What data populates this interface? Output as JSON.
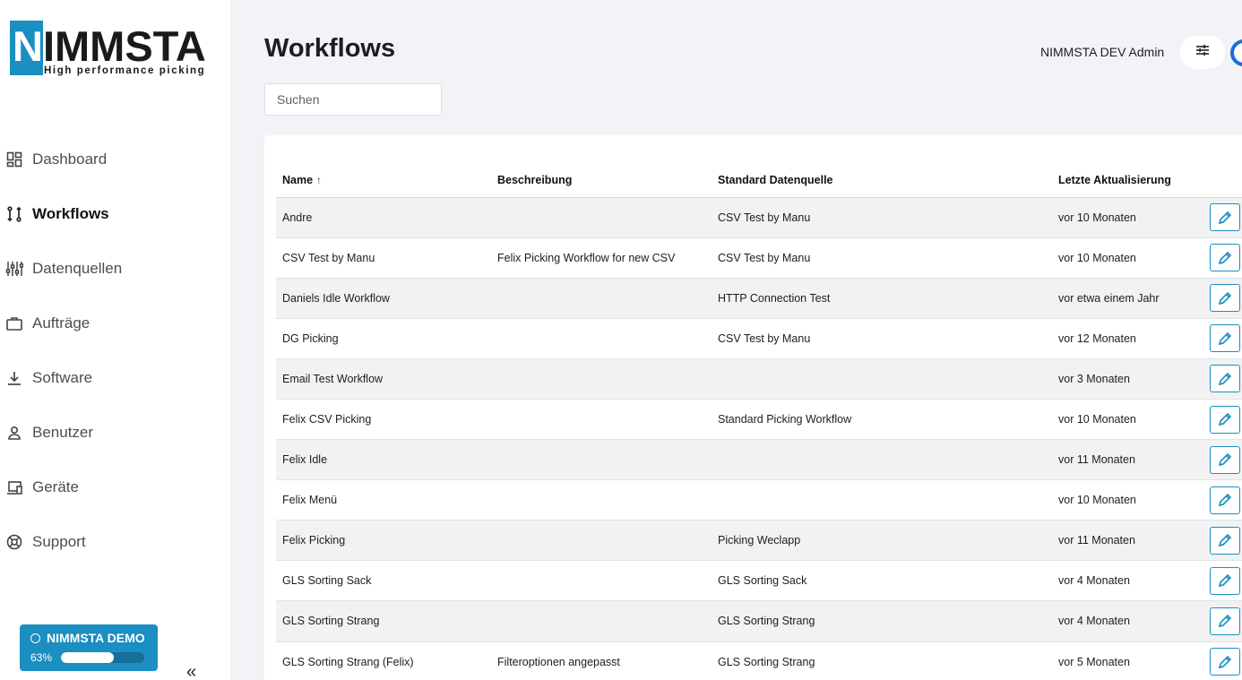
{
  "brand": {
    "name": "NIMMSTA",
    "tagline": "High performance picking"
  },
  "sidebar": {
    "items": [
      {
        "label": "Dashboard",
        "icon": "dashboard-icon",
        "active": false
      },
      {
        "label": "Workflows",
        "icon": "workflow-icon",
        "active": true
      },
      {
        "label": "Datenquellen",
        "icon": "sliders-icon",
        "active": false
      },
      {
        "label": "Aufträge",
        "icon": "briefcase-icon",
        "active": false
      },
      {
        "label": "Software",
        "icon": "download-icon",
        "active": false
      },
      {
        "label": "Benutzer",
        "icon": "user-icon",
        "active": false
      },
      {
        "label": "Geräte",
        "icon": "devices-icon",
        "active": false
      },
      {
        "label": "Support",
        "icon": "lifebuoy-icon",
        "active": false
      }
    ],
    "demo": {
      "title": "NIMMSTA DEMO",
      "percent_label": "63%",
      "progress": 0.63
    },
    "collapse_label": "«"
  },
  "header": {
    "title": "Workflows",
    "user": "NIMMSTA DEV Admin",
    "settings_icon": "settings-sliders-icon"
  },
  "search": {
    "placeholder": "Suchen",
    "value": ""
  },
  "table": {
    "columns": [
      "Name",
      "Beschreibung",
      "Standard Datenquelle",
      "Letzte Aktualisierung"
    ],
    "sort_indicator": "↑",
    "rows": [
      {
        "name": "Andre",
        "description": "",
        "source": "CSV Test by Manu",
        "updated": "vor 10 Monaten"
      },
      {
        "name": "CSV Test by Manu",
        "description": "Felix Picking Workflow for new CSV",
        "source": "CSV Test by Manu",
        "updated": "vor 10 Monaten"
      },
      {
        "name": "Daniels Idle Workflow",
        "description": "",
        "source": "HTTP Connection Test",
        "updated": "vor etwa einem Jahr"
      },
      {
        "name": "DG Picking",
        "description": "",
        "source": "CSV Test by Manu",
        "updated": "vor 12 Monaten"
      },
      {
        "name": "Email Test Workflow",
        "description": "",
        "source": "",
        "updated": "vor 3 Monaten"
      },
      {
        "name": "Felix CSV Picking",
        "description": "",
        "source": "Standard Picking Workflow",
        "updated": "vor 10 Monaten"
      },
      {
        "name": "Felix Idle",
        "description": "",
        "source": "",
        "updated": "vor 11 Monaten"
      },
      {
        "name": "Felix Menü",
        "description": "",
        "source": "",
        "updated": "vor 10 Monaten"
      },
      {
        "name": "Felix Picking",
        "description": "",
        "source": "Picking Weclapp",
        "updated": "vor 11 Monaten"
      },
      {
        "name": "GLS Sorting Sack",
        "description": "",
        "source": "GLS Sorting Sack",
        "updated": "vor 4 Monaten"
      },
      {
        "name": "GLS Sorting Strang",
        "description": "",
        "source": "GLS Sorting Strang",
        "updated": "vor 4 Monaten"
      },
      {
        "name": "GLS Sorting Strang (Felix)",
        "description": "Filteroptionen angepasst",
        "source": "GLS Sorting Strang",
        "updated": "vor 5 Monaten"
      }
    ],
    "edit_icon": "pencil-icon"
  },
  "colors": {
    "accent": "#1b8ec2",
    "avatar_ring": "#1b6fd6",
    "background": "#f1f3f6"
  }
}
